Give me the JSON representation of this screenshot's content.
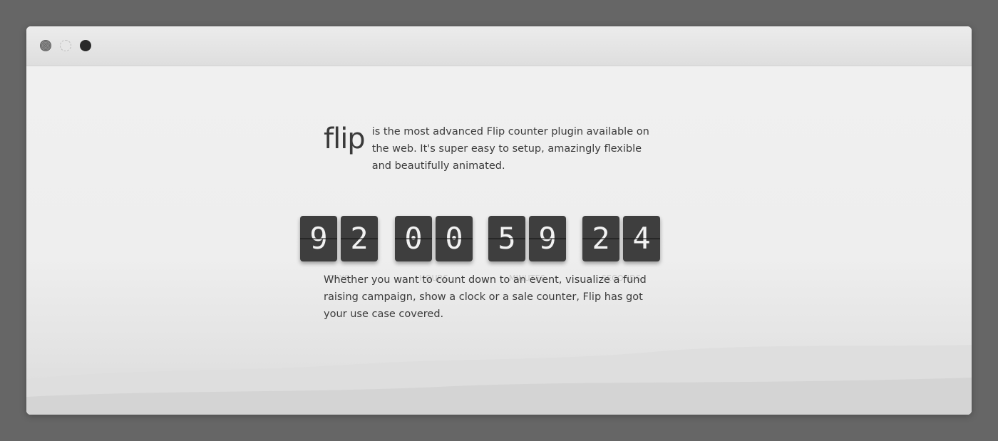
{
  "window": {
    "controls": [
      "close",
      "minimize",
      "maximize"
    ]
  },
  "hero": {
    "logo": "flip",
    "intro": "is the most advanced Flip counter plugin available on the web. It's super easy to setup, amazingly flexible and beautifully animated."
  },
  "counter": {
    "groups": [
      {
        "label": "DAYS",
        "digits": [
          "9",
          "2"
        ]
      },
      {
        "label": "HOURS",
        "digits": [
          "0",
          "0"
        ]
      },
      {
        "label": "MINUTES",
        "digits": [
          "5",
          "9"
        ]
      },
      {
        "label": "SECONDS",
        "digits": [
          "2",
          "4"
        ]
      }
    ]
  },
  "outro": "Whether you want to count down to an event, visualize a fund raising campaign, show a clock or a sale counter, Flip has got your use case covered.",
  "colors": {
    "card_bg": "#3e3e3e",
    "card_text": "#f2f2f2",
    "label": "#c8c8c8",
    "body_text": "#3b3b3b"
  }
}
